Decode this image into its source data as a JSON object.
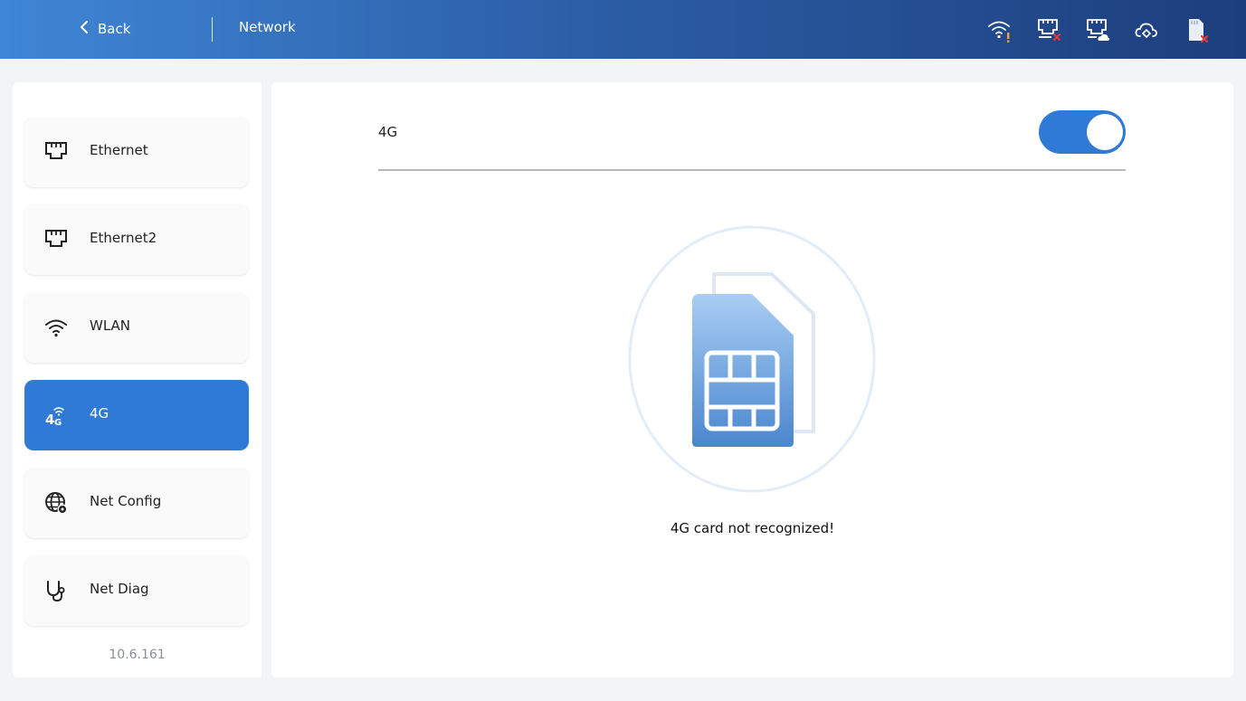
{
  "header": {
    "back_label": "Back",
    "title": "Network",
    "status_icons": [
      "wifi-warning-icon",
      "ethernet-error-icon",
      "ethernet-cloud-icon",
      "cloud-icon",
      "sd-card-error-icon"
    ]
  },
  "sidebar": {
    "items": [
      {
        "label": "Ethernet",
        "icon": "ethernet-icon",
        "active": false
      },
      {
        "label": "Ethernet2",
        "icon": "ethernet-icon",
        "active": false
      },
      {
        "label": "WLAN",
        "icon": "wifi-icon",
        "active": false
      },
      {
        "label": "4G",
        "icon": "4g-signal-icon",
        "active": true
      },
      {
        "label": "Net Config",
        "icon": "globe-gear-icon",
        "active": false
      },
      {
        "label": "Net Diag",
        "icon": "stethoscope-icon",
        "active": false
      }
    ],
    "version": "10.6.161"
  },
  "main": {
    "toggle_label": "4G",
    "toggle_on": true,
    "message": "4G card not recognized!"
  },
  "colors": {
    "accent": "#2f7ad4",
    "header_start": "#3f86d6",
    "header_end": "#1d3e7c",
    "warning": "#f5a623",
    "error": "#e53935"
  }
}
